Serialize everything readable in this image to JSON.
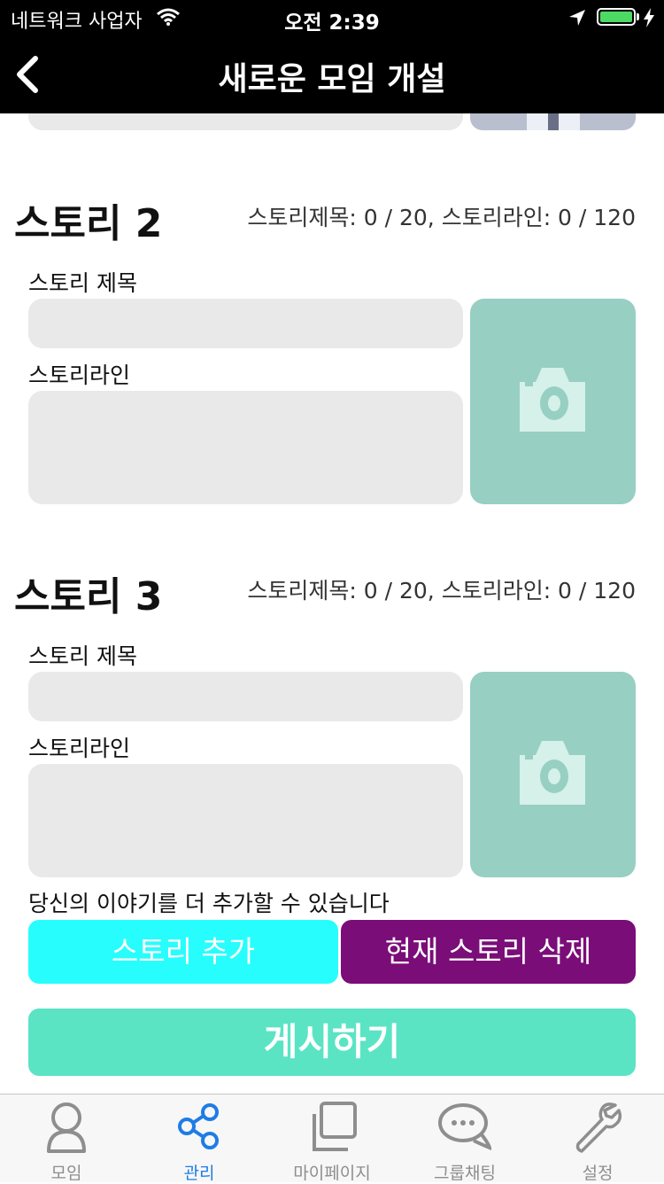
{
  "status_bar": {
    "carrier": "네트워크 사업자",
    "time": "오전 2:39",
    "battery_level": 1.0,
    "battery_color": "#4cd964"
  },
  "nav": {
    "title": "새로운 모임 개설",
    "back_icon": "chevron-left-icon"
  },
  "stories": [
    {
      "heading": "스토리 2",
      "counter": "스토리제목: 0 / 20, 스토리라인: 0 / 120",
      "title_label": "스토리 제목",
      "line_label": "스토리라인",
      "title_value": "",
      "line_value": "",
      "photo_icon": "camera-icon"
    },
    {
      "heading": "스토리 3",
      "counter": "스토리제목: 0 / 20, 스토리라인: 0 / 120",
      "title_label": "스토리 제목",
      "line_label": "스토리라인",
      "title_value": "",
      "line_value": "",
      "photo_icon": "camera-icon"
    }
  ],
  "hint": "당신의 이야기를 더 추가할 수 있습니다",
  "buttons": {
    "add_story": "스토리 추가",
    "delete_story": "현재 스토리 삭제",
    "post": "게시하기"
  },
  "colors": {
    "add_button": "#28fdfd",
    "delete_button": "#7a0d78",
    "post_button": "#5ae4c4",
    "photo_placeholder": "#97cfc3",
    "tab_active": "#1e7ce6"
  },
  "tab_bar": {
    "items": [
      {
        "label": "모임",
        "icon": "person-icon",
        "active": false
      },
      {
        "label": "관리",
        "icon": "share-icon",
        "active": true
      },
      {
        "label": "마이페이지",
        "icon": "squares-icon",
        "active": false
      },
      {
        "label": "그룹채팅",
        "icon": "chat-bubbles-icon",
        "active": false
      },
      {
        "label": "설정",
        "icon": "wrench-icon",
        "active": false
      }
    ]
  }
}
